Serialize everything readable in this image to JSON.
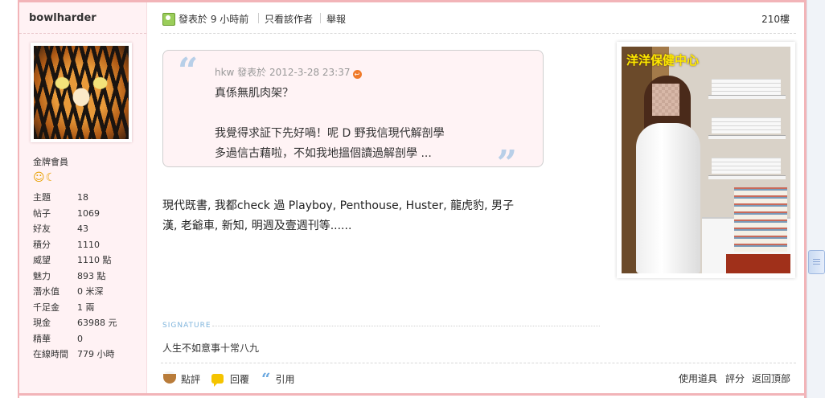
{
  "user": {
    "name": "bowlharder",
    "rank": "金牌會員",
    "rank_icons": "☺☾",
    "stats": [
      {
        "label": "主題",
        "value": "18"
      },
      {
        "label": "帖子",
        "value": "1069"
      },
      {
        "label": "好友",
        "value": "43"
      },
      {
        "label": "積分",
        "value": "1110"
      },
      {
        "label": "威望",
        "value": "1110 點"
      },
      {
        "label": "魅力",
        "value": "893 點"
      },
      {
        "label": "潛水值",
        "value": "0 米深"
      },
      {
        "label": "千足金",
        "value": "1 兩"
      },
      {
        "label": "現金",
        "value": "63988 元"
      },
      {
        "label": "精華",
        "value": "0"
      },
      {
        "label": "在線時間",
        "value": "779 小時"
      }
    ]
  },
  "post": {
    "posted_time": "發表於 9 小時前",
    "only_author": "只看該作者",
    "report": "舉報",
    "floor": "210樓",
    "quote": {
      "meta": "hkw 發表於 2012-3-28 23:37",
      "lines": [
        "真係無肌肉架？",
        "",
        "我覺得求証下先好喎！呢 D 野我信現代解剖學",
        "多過信古藉啦，不如我地搵個讀過解剖學 ..."
      ]
    },
    "message_lines": [
      "現代既書, 我都check 過 Playboy, Penthouse, Huster, 龍虎豹, 男子",
      "漢, 老爺車, 新知, 明週及壹週刊等......"
    ]
  },
  "ad": {
    "title": "洋洋保健中心"
  },
  "signature": {
    "label": "SIGNATURE",
    "text": "人生不如意事十常八九"
  },
  "footer": {
    "rate": "點評",
    "reply": "回覆",
    "quote": "引用",
    "use_tool": "使用道具",
    "score": "評分",
    "back_top": "返回頂部"
  }
}
